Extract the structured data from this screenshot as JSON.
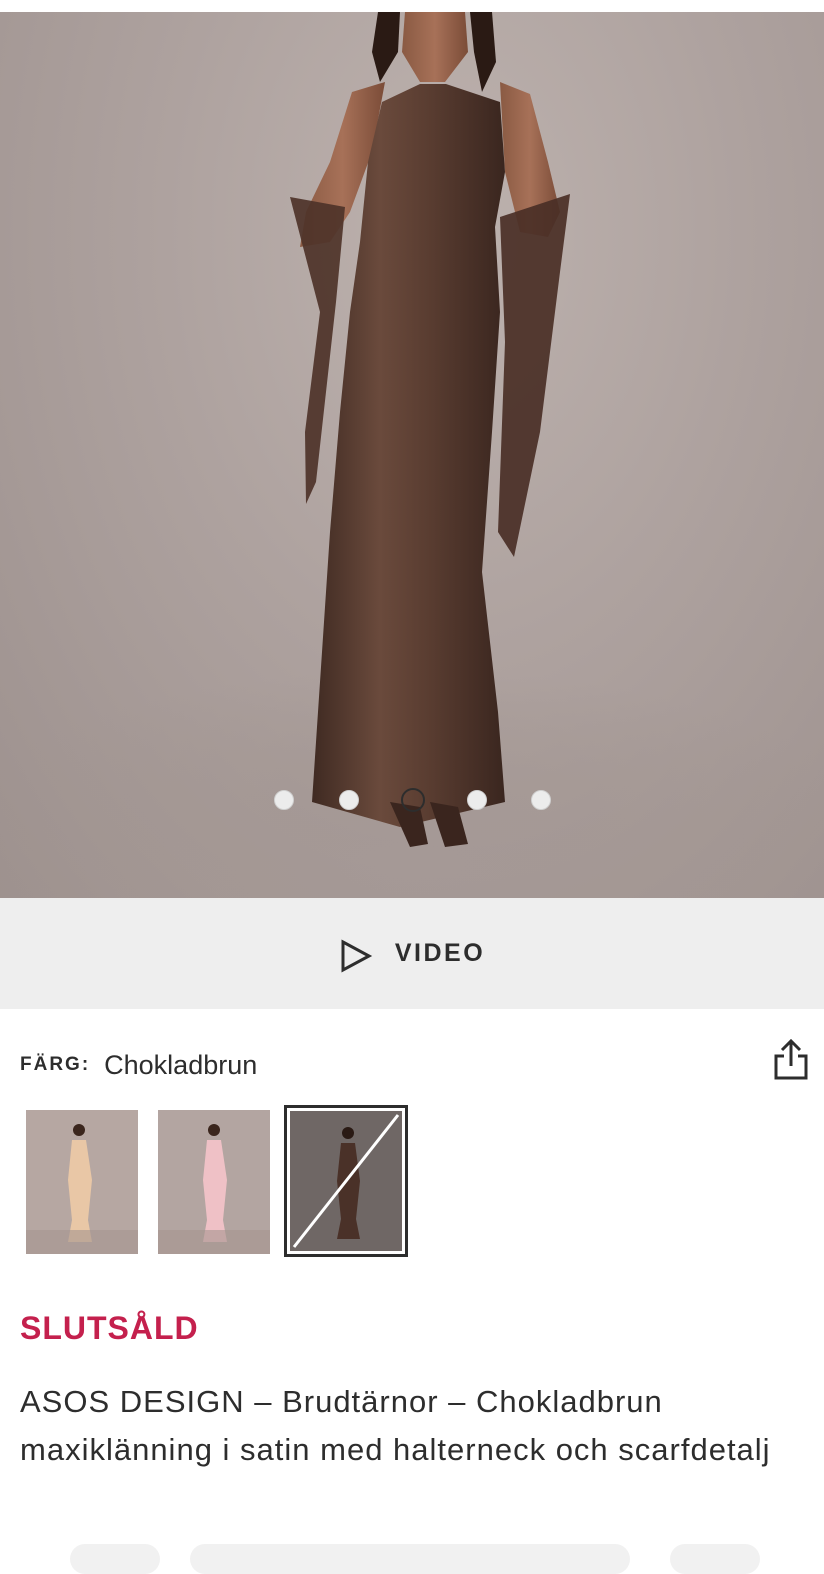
{
  "gallery": {
    "image_count": 5,
    "active_index": 2,
    "dot_labels": [
      "image-1",
      "image-2",
      "image-3",
      "image-4",
      "image-5"
    ]
  },
  "video": {
    "label": "VIDEO",
    "icon": "play-icon"
  },
  "color": {
    "key": "FÄRG:",
    "value": "Chokladbrun",
    "share_icon": "share-icon",
    "swatches": [
      {
        "name": "peach",
        "dress_color": "#e9c7a6",
        "selected": false,
        "sold_out": false
      },
      {
        "name": "pink",
        "dress_color": "#efc1c6",
        "selected": false,
        "sold_out": false
      },
      {
        "name": "chocolate",
        "dress_color": "#4a3128",
        "selected": true,
        "sold_out": true
      }
    ]
  },
  "product": {
    "status": "SLUTSÅLD",
    "status_color": "#c4204d",
    "title": "ASOS DESIGN – Brudtärnor – Chokladbrun maxiklänning i satin med halterneck och scarfdetalj"
  }
}
